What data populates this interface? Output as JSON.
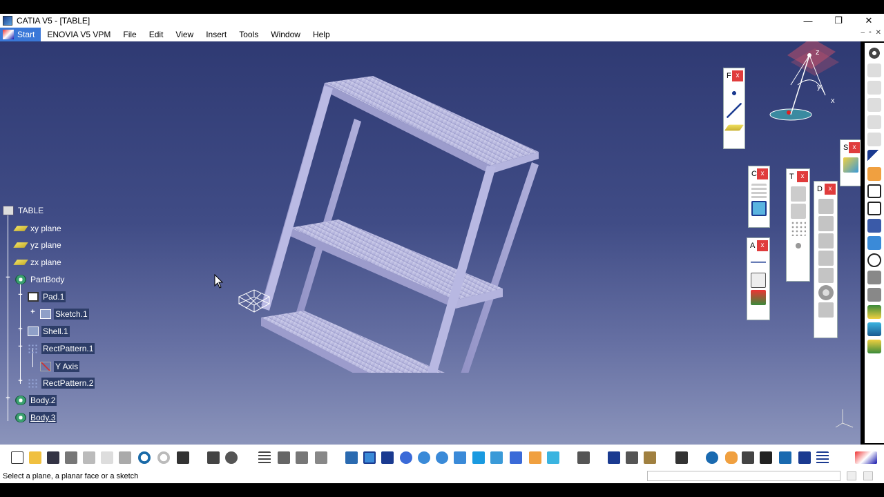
{
  "window": {
    "title": "CATIA V5 - [TABLE]",
    "minimize_glyph": "—",
    "restore_glyph": "❐",
    "close_glyph": "✕"
  },
  "menu": {
    "start": "Start",
    "items": [
      "ENOVIA V5 VPM",
      "File",
      "Edit",
      "View",
      "Insert",
      "Tools",
      "Window",
      "Help"
    ],
    "doc_controls": [
      "–",
      "▫",
      "✕"
    ]
  },
  "tree": {
    "root": "TABLE",
    "xy": "xy plane",
    "yz": "yz plane",
    "zx": "zx plane",
    "partbody": "PartBody",
    "pad": "Pad.1",
    "sketch": "Sketch.1",
    "shell": "Shell.1",
    "rect1": "RectPattern.1",
    "yaxis": "Y Axis",
    "rect2": "RectPattern.2",
    "body2": "Body.2",
    "body3": "Body.3"
  },
  "compass": {
    "z": "z",
    "y": "y",
    "x": "x"
  },
  "floating_toolbars": [
    {
      "letter": "F",
      "close": "x"
    },
    {
      "letter": "S",
      "close": "x"
    },
    {
      "letter": "C",
      "close": "x"
    },
    {
      "letter": "T",
      "close": "x"
    },
    {
      "letter": "D",
      "close": "x"
    },
    {
      "letter": "A",
      "close": "x"
    }
  ],
  "status": {
    "message": "Select a plane, a planar face or a sketch"
  },
  "colors": {
    "accent": "#3a78d8",
    "close": "#e03c3c",
    "tree_text": "#ffffff",
    "model": "#a8a8d8"
  }
}
